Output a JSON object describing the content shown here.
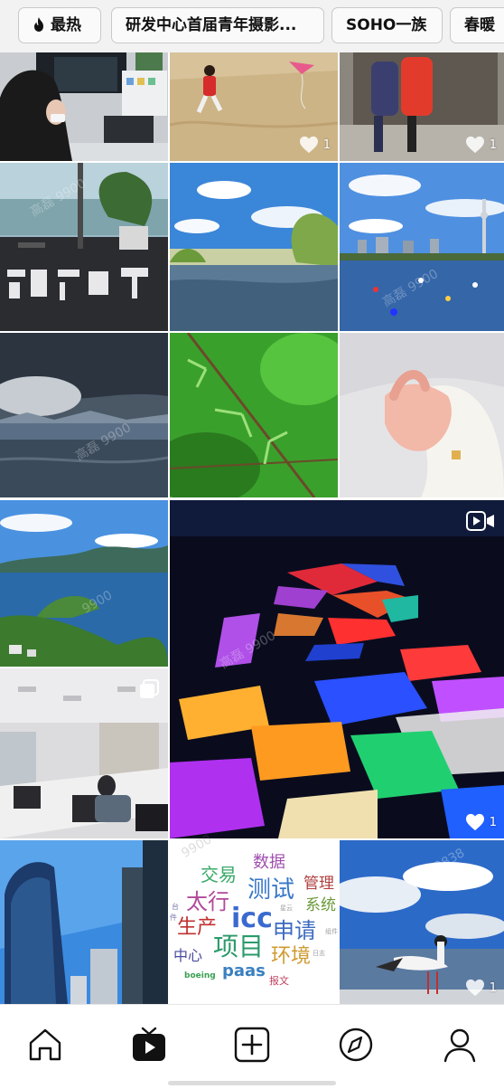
{
  "tags": [
    {
      "label": "最热",
      "icon": "flame-icon"
    },
    {
      "label": "研发中心首届青年摄影..."
    },
    {
      "label": "SOHO一族"
    },
    {
      "label": "春暖"
    }
  ],
  "posts": [
    {
      "id": "office-desk"
    },
    {
      "id": "child-running",
      "likes": "1"
    },
    {
      "id": "kids-sculpture",
      "likes": "1"
    },
    {
      "id": "window-gaojia"
    },
    {
      "id": "lake-willows"
    },
    {
      "id": "lake-tower"
    },
    {
      "id": "storm-lake"
    },
    {
      "id": "green-leaves"
    },
    {
      "id": "baby-hand"
    },
    {
      "id": "lake-island"
    },
    {
      "id": "night-lights",
      "likes": "1",
      "badge": "video-icon"
    },
    {
      "id": "meeting-room",
      "badge": "gallery-icon"
    },
    {
      "id": "skyscrapers"
    },
    {
      "id": "word-cloud"
    },
    {
      "id": "seagull",
      "likes": "1"
    }
  ],
  "wordcloud": {
    "words": [
      "数据",
      "交易",
      "测试",
      "管理",
      "太行",
      "系统",
      "icc",
      "生产",
      "申请",
      "项目",
      "中心",
      "环境",
      "paas",
      "boeing",
      "报文",
      "星云",
      "日志",
      "组件",
      "台",
      "件"
    ]
  },
  "watermarks": [
    "高磊 9900",
    "高磊 9900",
    "高磊 9900",
    "高磊 9900",
    "9900",
    "9900",
    "2838"
  ],
  "nav": [
    {
      "name": "home-icon"
    },
    {
      "name": "video-tab-icon"
    },
    {
      "name": "add-icon"
    },
    {
      "name": "discover-icon"
    },
    {
      "name": "profile-icon"
    }
  ],
  "colors": {
    "tag_bg": "#f2f2f2",
    "nav_active": "#111111",
    "like_white": "#ffffff"
  }
}
